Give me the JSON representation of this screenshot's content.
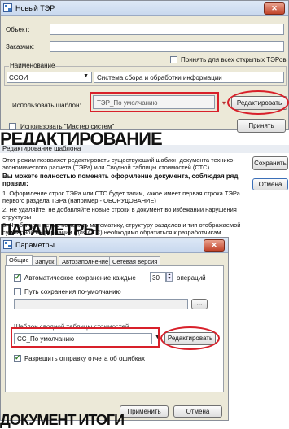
{
  "win1": {
    "title": "Новый ТЭР",
    "close": "✕",
    "object_label": "Объект:",
    "customer_label": "Заказчик:",
    "apply_all_label": "Принять для всех открытых ТЭРов",
    "naming_label": "Наименование",
    "naming_code": "ССОИ",
    "naming_text": "Система сбора и обработки информации",
    "template_label": "Использовать шаблон:",
    "template_value": "ТЭР_По умолчанию",
    "edit_button": "Редактировать",
    "master_label": "Использовать \"Мастер систем\"",
    "accept_button": "Принять"
  },
  "overlay1": "РЕДАКТИРОВАНИЕ",
  "win2": {
    "title": "Редактирование шаблона",
    "intro": "Этот режим позволяет редактировать существующий шаблон документа технико-экономического расчета (ТЭРа) или Сводной таблицы стоимостей (СТС)",
    "bold": "Вы можете полностью поменять оформление документа, соблюдая ряд правил:",
    "rule1": "1. Оформление строк ТЭРа или СТС будет таким, какое имеет первая строка ТЭРа первого раздела ТЭРа (например - ОБОРУДОВАНИЕ)",
    "rule2": "2. Не удаляйте, не добавляйте новые строки в документ во избежании нарушения структуры",
    "rule3": "3. Чтобы полностью поменять математику, структуру разделов и тип отображаемой суммарной информации (для СТС) необходимо обратиться к разработчикам",
    "save_button": "Сохранить",
    "cancel_button": "Отмена"
  },
  "overlay2": "ПАРАМЕТРЫ",
  "win3": {
    "title": "Параметры",
    "close": "✕",
    "tabs": [
      "Общие",
      "Запуск",
      "Автозаполнение",
      "Сетевая версия"
    ],
    "autosave_label": "Автоматическое сохранение каждые",
    "autosave_value": "30",
    "autosave_unit": "операций",
    "savepath_label": "Путь сохранения по-умолчанию",
    "browse": "...",
    "summary_template_label": "Шаблон сводной таблицы стоимостей",
    "summary_template_value": "СС_По умолчанию",
    "edit_button": "Редактировать",
    "report_label": "Разрешить отправку отчета об ошибках",
    "apply_button": "Применить",
    "cancel_button": "Отмена"
  },
  "overlay3": "ДОКУМЕНТ ИТОГИ",
  "colors": {
    "highlight": "#d8202a",
    "dialog_bg": "#ece9d8"
  }
}
